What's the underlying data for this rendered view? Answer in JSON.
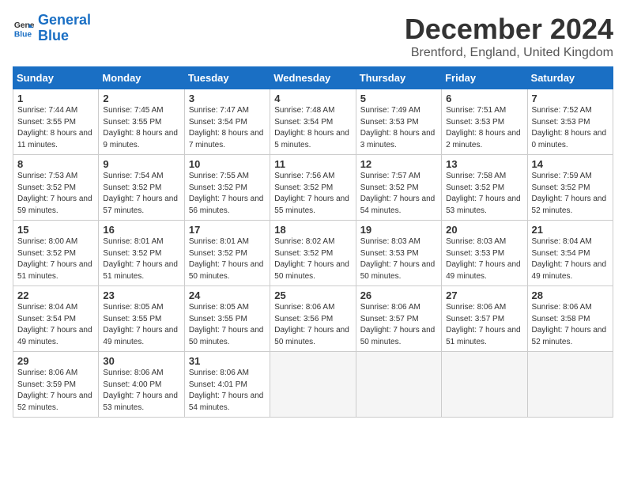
{
  "logo": {
    "line1": "General",
    "line2": "Blue"
  },
  "title": "December 2024",
  "subtitle": "Brentford, England, United Kingdom",
  "weekdays": [
    "Sunday",
    "Monday",
    "Tuesday",
    "Wednesday",
    "Thursday",
    "Friday",
    "Saturday"
  ],
  "weeks": [
    [
      {
        "day": "1",
        "sunrise": "Sunrise: 7:44 AM",
        "sunset": "Sunset: 3:55 PM",
        "daylight": "Daylight: 8 hours and 11 minutes."
      },
      {
        "day": "2",
        "sunrise": "Sunrise: 7:45 AM",
        "sunset": "Sunset: 3:55 PM",
        "daylight": "Daylight: 8 hours and 9 minutes."
      },
      {
        "day": "3",
        "sunrise": "Sunrise: 7:47 AM",
        "sunset": "Sunset: 3:54 PM",
        "daylight": "Daylight: 8 hours and 7 minutes."
      },
      {
        "day": "4",
        "sunrise": "Sunrise: 7:48 AM",
        "sunset": "Sunset: 3:54 PM",
        "daylight": "Daylight: 8 hours and 5 minutes."
      },
      {
        "day": "5",
        "sunrise": "Sunrise: 7:49 AM",
        "sunset": "Sunset: 3:53 PM",
        "daylight": "Daylight: 8 hours and 3 minutes."
      },
      {
        "day": "6",
        "sunrise": "Sunrise: 7:51 AM",
        "sunset": "Sunset: 3:53 PM",
        "daylight": "Daylight: 8 hours and 2 minutes."
      },
      {
        "day": "7",
        "sunrise": "Sunrise: 7:52 AM",
        "sunset": "Sunset: 3:53 PM",
        "daylight": "Daylight: 8 hours and 0 minutes."
      }
    ],
    [
      {
        "day": "8",
        "sunrise": "Sunrise: 7:53 AM",
        "sunset": "Sunset: 3:52 PM",
        "daylight": "Daylight: 7 hours and 59 minutes."
      },
      {
        "day": "9",
        "sunrise": "Sunrise: 7:54 AM",
        "sunset": "Sunset: 3:52 PM",
        "daylight": "Daylight: 7 hours and 57 minutes."
      },
      {
        "day": "10",
        "sunrise": "Sunrise: 7:55 AM",
        "sunset": "Sunset: 3:52 PM",
        "daylight": "Daylight: 7 hours and 56 minutes."
      },
      {
        "day": "11",
        "sunrise": "Sunrise: 7:56 AM",
        "sunset": "Sunset: 3:52 PM",
        "daylight": "Daylight: 7 hours and 55 minutes."
      },
      {
        "day": "12",
        "sunrise": "Sunrise: 7:57 AM",
        "sunset": "Sunset: 3:52 PM",
        "daylight": "Daylight: 7 hours and 54 minutes."
      },
      {
        "day": "13",
        "sunrise": "Sunrise: 7:58 AM",
        "sunset": "Sunset: 3:52 PM",
        "daylight": "Daylight: 7 hours and 53 minutes."
      },
      {
        "day": "14",
        "sunrise": "Sunrise: 7:59 AM",
        "sunset": "Sunset: 3:52 PM",
        "daylight": "Daylight: 7 hours and 52 minutes."
      }
    ],
    [
      {
        "day": "15",
        "sunrise": "Sunrise: 8:00 AM",
        "sunset": "Sunset: 3:52 PM",
        "daylight": "Daylight: 7 hours and 51 minutes."
      },
      {
        "day": "16",
        "sunrise": "Sunrise: 8:01 AM",
        "sunset": "Sunset: 3:52 PM",
        "daylight": "Daylight: 7 hours and 51 minutes."
      },
      {
        "day": "17",
        "sunrise": "Sunrise: 8:01 AM",
        "sunset": "Sunset: 3:52 PM",
        "daylight": "Daylight: 7 hours and 50 minutes."
      },
      {
        "day": "18",
        "sunrise": "Sunrise: 8:02 AM",
        "sunset": "Sunset: 3:52 PM",
        "daylight": "Daylight: 7 hours and 50 minutes."
      },
      {
        "day": "19",
        "sunrise": "Sunrise: 8:03 AM",
        "sunset": "Sunset: 3:53 PM",
        "daylight": "Daylight: 7 hours and 50 minutes."
      },
      {
        "day": "20",
        "sunrise": "Sunrise: 8:03 AM",
        "sunset": "Sunset: 3:53 PM",
        "daylight": "Daylight: 7 hours and 49 minutes."
      },
      {
        "day": "21",
        "sunrise": "Sunrise: 8:04 AM",
        "sunset": "Sunset: 3:54 PM",
        "daylight": "Daylight: 7 hours and 49 minutes."
      }
    ],
    [
      {
        "day": "22",
        "sunrise": "Sunrise: 8:04 AM",
        "sunset": "Sunset: 3:54 PM",
        "daylight": "Daylight: 7 hours and 49 minutes."
      },
      {
        "day": "23",
        "sunrise": "Sunrise: 8:05 AM",
        "sunset": "Sunset: 3:55 PM",
        "daylight": "Daylight: 7 hours and 49 minutes."
      },
      {
        "day": "24",
        "sunrise": "Sunrise: 8:05 AM",
        "sunset": "Sunset: 3:55 PM",
        "daylight": "Daylight: 7 hours and 50 minutes."
      },
      {
        "day": "25",
        "sunrise": "Sunrise: 8:06 AM",
        "sunset": "Sunset: 3:56 PM",
        "daylight": "Daylight: 7 hours and 50 minutes."
      },
      {
        "day": "26",
        "sunrise": "Sunrise: 8:06 AM",
        "sunset": "Sunset: 3:57 PM",
        "daylight": "Daylight: 7 hours and 50 minutes."
      },
      {
        "day": "27",
        "sunrise": "Sunrise: 8:06 AM",
        "sunset": "Sunset: 3:57 PM",
        "daylight": "Daylight: 7 hours and 51 minutes."
      },
      {
        "day": "28",
        "sunrise": "Sunrise: 8:06 AM",
        "sunset": "Sunset: 3:58 PM",
        "daylight": "Daylight: 7 hours and 52 minutes."
      }
    ],
    [
      {
        "day": "29",
        "sunrise": "Sunrise: 8:06 AM",
        "sunset": "Sunset: 3:59 PM",
        "daylight": "Daylight: 7 hours and 52 minutes."
      },
      {
        "day": "30",
        "sunrise": "Sunrise: 8:06 AM",
        "sunset": "Sunset: 4:00 PM",
        "daylight": "Daylight: 7 hours and 53 minutes."
      },
      {
        "day": "31",
        "sunrise": "Sunrise: 8:06 AM",
        "sunset": "Sunset: 4:01 PM",
        "daylight": "Daylight: 7 hours and 54 minutes."
      },
      null,
      null,
      null,
      null
    ]
  ]
}
